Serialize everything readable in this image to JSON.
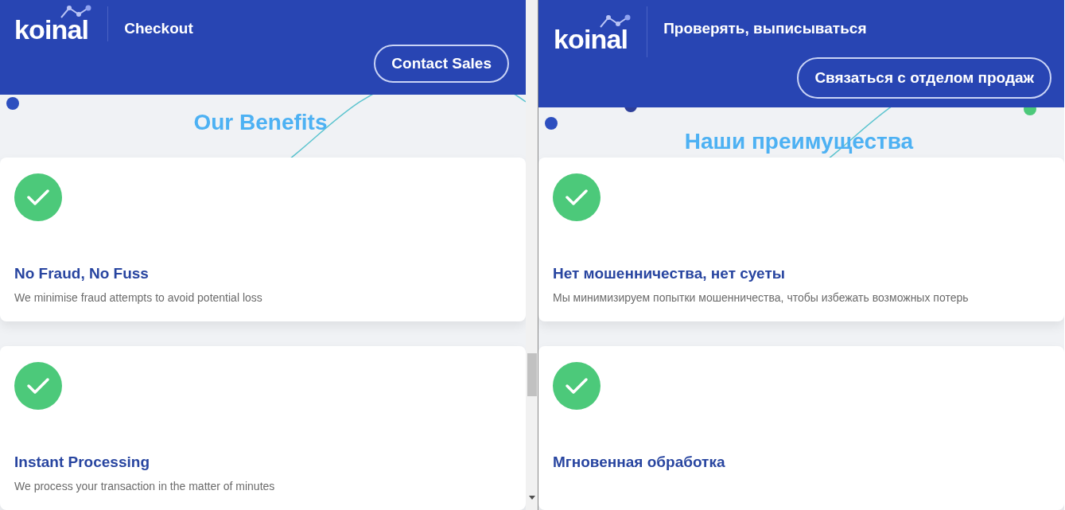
{
  "panes": [
    {
      "logo": "koinal",
      "title": "Checkout",
      "contact_button": "Contact Sales",
      "section_title": "Our Benefits",
      "benefits": [
        {
          "title": "No Fraud, No Fuss",
          "description": "We minimise fraud attempts to avoid potential loss"
        },
        {
          "title": "Instant Processing",
          "description": "We process your transaction in the matter of minutes"
        }
      ],
      "scrollbar": true
    },
    {
      "logo": "koinal",
      "title": "Проверять, выписываться",
      "contact_button": "Связаться с отделом продаж",
      "section_title": "Наши преимущества",
      "benefits": [
        {
          "title": "Нет мошенничества, нет суеты",
          "description": "Мы минимизируем попытки мошенничества, чтобы избежать возможных потерь"
        },
        {
          "title": "Мгновенная обработка"
        }
      ],
      "scrollbar": false
    }
  ]
}
